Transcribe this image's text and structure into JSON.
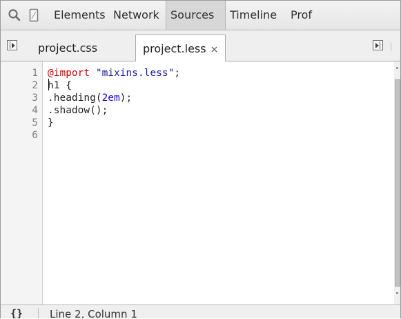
{
  "toolbar": {
    "icons": [
      "search-icon",
      "device-mode-icon"
    ],
    "tabs": [
      {
        "label": "Elements",
        "selected": false
      },
      {
        "label": "Network",
        "selected": false
      },
      {
        "label": "Sources",
        "selected": true
      },
      {
        "label": "Timeline",
        "selected": false
      },
      {
        "label": "Prof",
        "selected": false
      }
    ]
  },
  "file_tabs": {
    "tabs": [
      {
        "label": "project.css",
        "active": false
      },
      {
        "label": "project.less",
        "active": true,
        "close_glyph": "×"
      }
    ]
  },
  "editor": {
    "line_numbers": [
      "1",
      "2",
      "3",
      "4",
      "5",
      "6"
    ],
    "lines": [
      {
        "parts": [
          {
            "text": "@import",
            "type": "at"
          },
          {
            "text": " ",
            "type": "plain"
          },
          {
            "text": "\"mixins.less\"",
            "type": "str"
          },
          {
            "text": ";",
            "type": "plain"
          }
        ]
      },
      {
        "parts": [
          {
            "text": "h1 {",
            "type": "plain"
          }
        ]
      },
      {
        "parts": [
          {
            "text": ".heading(",
            "type": "plain"
          },
          {
            "text": "2em",
            "type": "num"
          },
          {
            "text": ");",
            "type": "plain"
          }
        ]
      },
      {
        "parts": [
          {
            "text": ".shadow();",
            "type": "plain"
          }
        ]
      },
      {
        "parts": [
          {
            "text": "}",
            "type": "plain"
          }
        ]
      },
      {
        "parts": []
      }
    ]
  },
  "statusbar": {
    "pretty_print_glyph": "{}",
    "cursor_position": "Line 2, Column 1"
  },
  "colors": {
    "at_rule": "#c80000",
    "string": "#1a1aa6",
    "number": "#1c00cf",
    "selected_tab_bg": "#d7d7d7"
  }
}
